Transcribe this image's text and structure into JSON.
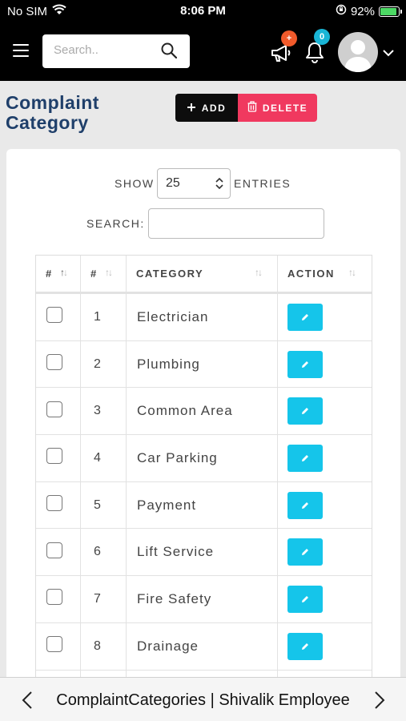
{
  "status_bar": {
    "carrier": "No SIM",
    "time": "8:06 PM",
    "battery": "92%",
    "icons": [
      "wifi-icon",
      "orientation-lock-icon",
      "battery-charging-icon"
    ]
  },
  "header": {
    "search_placeholder": "Search..",
    "notification_badge_a": "+",
    "notification_badge_b": "0",
    "accent_orange": "#f15a2b",
    "accent_cyan": "#19b5d6"
  },
  "page": {
    "title_line1": "Complaint",
    "title_line2": "Category",
    "add_label": "ADD",
    "delete_label": "DELETE",
    "delete_color": "#f0395f"
  },
  "controls": {
    "show_label": "SHOW",
    "entries_value": "25",
    "entries_label": "ENTRIES",
    "search_label": "SEARCH:",
    "search_value": ""
  },
  "table": {
    "columns": [
      "#",
      "#",
      "CATEGORY",
      "ACTION"
    ],
    "rows": [
      {
        "num": "1",
        "category": "Electrician"
      },
      {
        "num": "2",
        "category": "Plumbing"
      },
      {
        "num": "3",
        "category": "Common Area"
      },
      {
        "num": "4",
        "category": "Car Parking"
      },
      {
        "num": "5",
        "category": "Payment"
      },
      {
        "num": "6",
        "category": "Lift Service"
      },
      {
        "num": "7",
        "category": "Fire Safety"
      },
      {
        "num": "8",
        "category": "Drainage"
      },
      {
        "num": "",
        "category": ""
      }
    ],
    "edit_color": "#15c5ea"
  },
  "bottom_bar": {
    "title": "ComplaintCategories | Shivalik Employee"
  }
}
